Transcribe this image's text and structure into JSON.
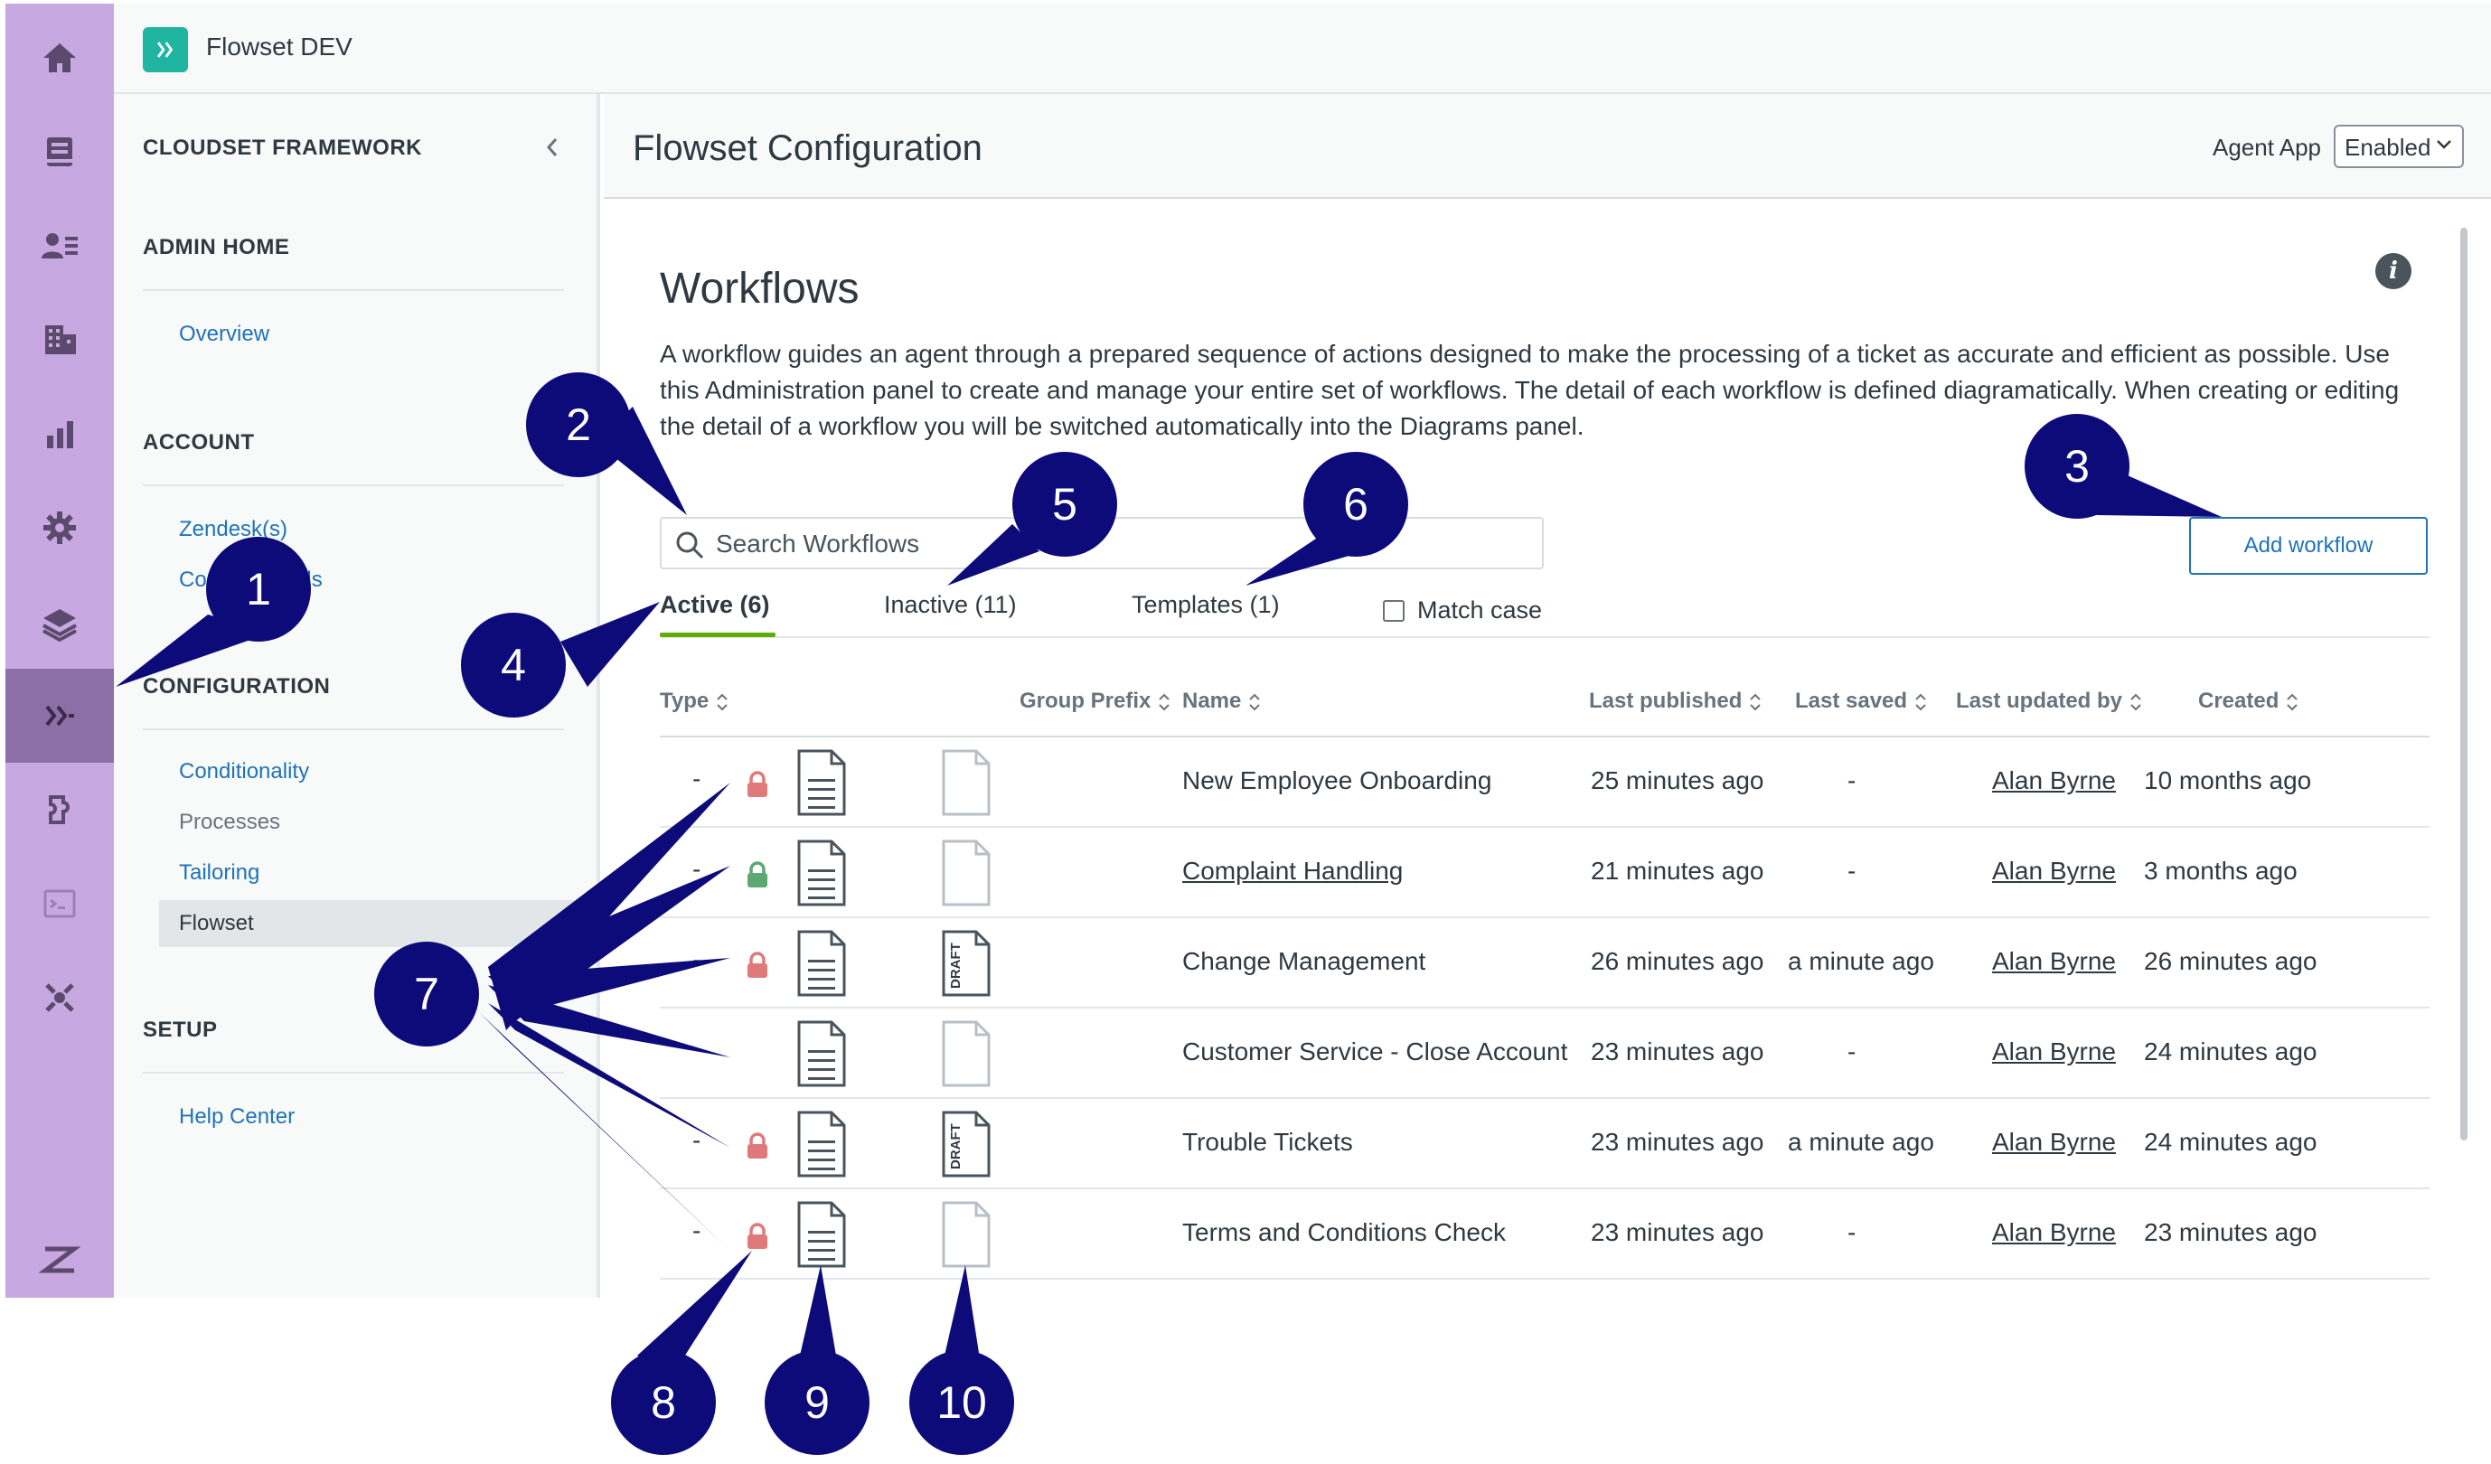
{
  "app": {
    "title": "Flowset DEV"
  },
  "rail": {
    "icons": [
      "home-icon",
      "tickets-icon",
      "users-icon",
      "organizations-icon",
      "reporting-icon",
      "settings-icon",
      "layers-icon",
      "flowset-icon",
      "integrations-icon",
      "terminal-icon",
      "connections-icon",
      "zendesk-logo-icon"
    ],
    "active": "flowset-icon"
  },
  "sidenav": {
    "title": "CLOUDSET FRAMEWORK",
    "sections": [
      {
        "heading": "ADMIN HOME",
        "items": [
          {
            "label": "Overview",
            "state": "link"
          }
        ]
      },
      {
        "heading": "ACCOUNT",
        "items": [
          {
            "label": "Zendesk(s)",
            "state": "link"
          },
          {
            "label": "Contact details",
            "state": "link"
          }
        ]
      },
      {
        "heading": "CONFIGURATION",
        "items": [
          {
            "label": "Conditionality",
            "state": "link"
          },
          {
            "label": "Processes",
            "state": "muted"
          },
          {
            "label": "Tailoring",
            "state": "link"
          },
          {
            "label": "Flowset",
            "state": "selected"
          }
        ]
      },
      {
        "heading": "SETUP",
        "items": [
          {
            "label": "Help Center",
            "state": "link"
          }
        ]
      }
    ]
  },
  "header": {
    "title": "Flowset Configuration",
    "agent_app_label": "Agent App",
    "agent_app_value": "Enabled"
  },
  "workflows": {
    "title": "Workflows",
    "description": "A workflow guides an agent through a prepared sequence of actions designed to make the processing of a ticket as accurate and efficient as possible. Use this Administration panel to create and manage your entire set of workflows. The detail of each workflow is defined diagramatically. When creating or editing the detail of a workflow you will be switched automatically into the Diagrams panel.",
    "search_placeholder": "Search Workflows",
    "add_button": "Add workflow",
    "tabs": [
      {
        "label": "Active (6)",
        "active": true
      },
      {
        "label": "Inactive (11)",
        "active": false
      },
      {
        "label": "Templates (1)",
        "active": false
      }
    ],
    "match_case_label": "Match case",
    "match_case_checked": false,
    "columns": [
      "Type",
      "Group Prefix",
      "Name",
      "Last published",
      "Last saved",
      "Last updated by",
      "Created"
    ],
    "rows": [
      {
        "type": "-",
        "lock": "locked",
        "draft": false,
        "name": "New Employee Onboarding",
        "name_link": false,
        "last_published": "25 minutes ago",
        "last_saved": "-",
        "updated_by": "Alan Byrne",
        "created": "10 months ago"
      },
      {
        "type": "-",
        "lock": "unlocked",
        "draft": false,
        "name": "Complaint Handling",
        "name_link": true,
        "last_published": "21 minutes ago",
        "last_saved": "-",
        "updated_by": "Alan Byrne",
        "created": "3 months ago"
      },
      {
        "type": "-",
        "lock": "locked",
        "draft": true,
        "name": "Change Management",
        "name_link": false,
        "last_published": "26 minutes ago",
        "last_saved": "a minute ago",
        "updated_by": "Alan Byrne",
        "created": "26 minutes ago"
      },
      {
        "type": "",
        "lock": "none",
        "draft": false,
        "name": "Customer Service - Close Account",
        "name_link": false,
        "last_published": "23 minutes ago",
        "last_saved": "-",
        "updated_by": "Alan Byrne",
        "created": "24 minutes ago"
      },
      {
        "type": "-",
        "lock": "locked",
        "draft": true,
        "name": "Trouble Tickets",
        "name_link": false,
        "last_published": "23 minutes ago",
        "last_saved": "a minute ago",
        "updated_by": "Alan Byrne",
        "created": "24 minutes ago"
      },
      {
        "type": "-",
        "lock": "locked",
        "draft": false,
        "name": "Terms and Conditions Check",
        "name_link": false,
        "last_published": "23 minutes ago",
        "last_saved": "-",
        "updated_by": "Alan Byrne",
        "created": "23 minutes ago"
      }
    ],
    "draft_label": "DRAFT"
  },
  "annotations": {
    "labels": [
      "1",
      "2",
      "3",
      "4",
      "5",
      "6",
      "7",
      "8",
      "9",
      "10"
    ]
  },
  "colors": {
    "rail": "#c8a8e0",
    "rail_active": "#8c6fa6",
    "brand": "#1fb5a0",
    "link": "#1f73b7",
    "tab_active": "#5eae00",
    "lock_locked": "#e07a7a",
    "lock_unlocked": "#5aa874",
    "annotation": "#0d0a7a"
  }
}
